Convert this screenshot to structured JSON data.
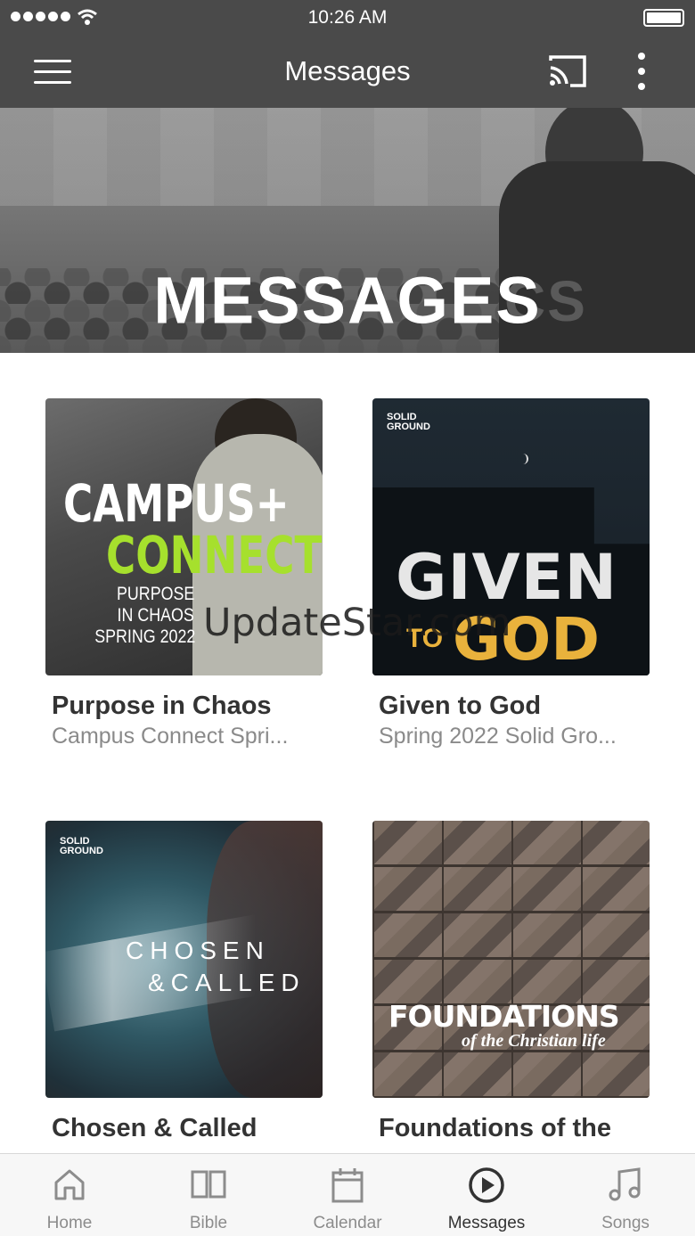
{
  "status_bar": {
    "time": "10:26 AM"
  },
  "app_bar": {
    "title": "Messages"
  },
  "hero": {
    "title": "MESSAGES",
    "shirt_text": "CS"
  },
  "cards": [
    {
      "name": "Purpose in Chaos",
      "subtitle": "Campus Connect Spri...",
      "art": {
        "line1": "CAMPUS+",
        "line2": "CONNECT",
        "line3": "PURPOSE",
        "line4": "IN CHAOS",
        "line5": "SPRING 2022"
      }
    },
    {
      "name": "Given to God",
      "subtitle": "Spring 2022 Solid Gro...",
      "art": {
        "logo": "SOLID GROUND",
        "line1": "GIVEN",
        "line2": "TO",
        "line3": "GOD"
      }
    },
    {
      "name": "Chosen & Called",
      "subtitle": "",
      "art": {
        "logo": "SOLID GROUND",
        "line1": "CHOSEN",
        "line2": "&CALLED"
      }
    },
    {
      "name": "Foundations of the",
      "subtitle": "",
      "art": {
        "line1": "FOUNDATIONS",
        "line2": "of the Christian life"
      }
    }
  ],
  "watermark": "UpdateStar.com",
  "tabs": [
    {
      "label": "Home",
      "icon": "home-icon"
    },
    {
      "label": "Bible",
      "icon": "book-icon"
    },
    {
      "label": "Calendar",
      "icon": "calendar-icon"
    },
    {
      "label": "Messages",
      "icon": "play-circle-icon",
      "active": true
    },
    {
      "label": "Songs",
      "icon": "music-note-icon"
    }
  ],
  "colors": {
    "app_bar": "#4a4a4a",
    "active_tab": "#333333",
    "inactive_tab": "#8c8c8c",
    "accent_green": "#a6e02d",
    "accent_gold": "#e9b23c"
  }
}
